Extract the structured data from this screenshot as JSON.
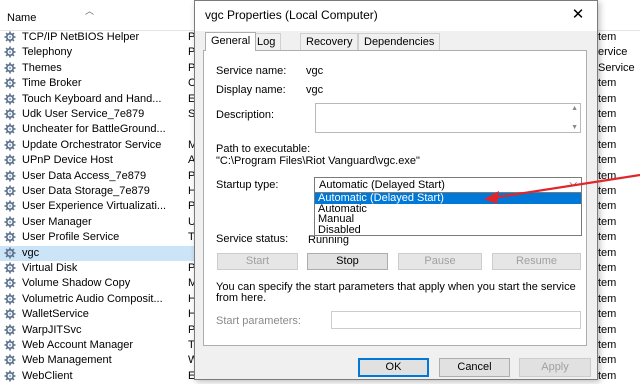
{
  "services": {
    "column_name": "Name",
    "rows": [
      {
        "name": "TCP/IP NetBIOS Helper",
        "desc": "P"
      },
      {
        "name": "Telephony",
        "desc": "P"
      },
      {
        "name": "Themes",
        "desc": "P"
      },
      {
        "name": "Time Broker",
        "desc": "C"
      },
      {
        "name": "Touch Keyboard and Hand...",
        "desc": "E"
      },
      {
        "name": "Udk User Service_7e879",
        "desc": "S"
      },
      {
        "name": "Uncheater for BattleGround...",
        "desc": ""
      },
      {
        "name": "Update Orchestrator Service",
        "desc": "M"
      },
      {
        "name": "UPnP Device Host",
        "desc": "A"
      },
      {
        "name": "User Data Access_7e879",
        "desc": "P"
      },
      {
        "name": "User Data Storage_7e879",
        "desc": "H"
      },
      {
        "name": "User Experience Virtualizati...",
        "desc": "P"
      },
      {
        "name": "User Manager",
        "desc": "U"
      },
      {
        "name": "User Profile Service",
        "desc": "T"
      },
      {
        "name": "vgc",
        "desc": ""
      },
      {
        "name": "Virtual Disk",
        "desc": "P"
      },
      {
        "name": "Volume Shadow Copy",
        "desc": "M"
      },
      {
        "name": "Volumetric Audio Composit...",
        "desc": "H"
      },
      {
        "name": "WalletService",
        "desc": "H"
      },
      {
        "name": "WarpJITSvc",
        "desc": "P"
      },
      {
        "name": "Web Account Manager",
        "desc": "T"
      },
      {
        "name": "Web Management",
        "desc": "W"
      },
      {
        "name": "WebClient",
        "desc": "E"
      }
    ],
    "right_column": [
      "tem",
      "ervice",
      "Service",
      "tem",
      "tem",
      "tem",
      "tem",
      "tem",
      "tem",
      "tem",
      "tem",
      "tem",
      "tem",
      "tem",
      "tem",
      "tem",
      "tem",
      "tem",
      "tem",
      "tem",
      "tem",
      "tem",
      "tem"
    ]
  },
  "dialog": {
    "title": "vgc Properties (Local Computer)",
    "close_glyph": "✕",
    "tabs": [
      "General",
      "Log On",
      "Recovery",
      "Dependencies"
    ],
    "service_name_label": "Service name:",
    "service_name_value": "vgc",
    "display_name_label": "Display name:",
    "display_name_value": "vgc",
    "description_label": "Description:",
    "path_label": "Path to executable:",
    "path_value": "\"C:\\Program Files\\Riot Vanguard\\vgc.exe\"",
    "startup_type_label": "Startup type:",
    "startup_type_value": "Automatic (Delayed Start)",
    "startup_options": [
      "Automatic (Delayed Start)",
      "Automatic",
      "Manual",
      "Disabled"
    ],
    "service_status_label": "Service status:",
    "service_status_value": "Running",
    "start_label": "Start",
    "stop_label": "Stop",
    "pause_label": "Pause",
    "resume_label": "Resume",
    "hint_text_line1": "You can specify the start parameters that apply when you start the service",
    "hint_text_line2": "from here.",
    "start_params_label": "Start parameters:",
    "ok_label": "OK",
    "cancel_label": "Cancel",
    "apply_label": "Apply"
  },
  "colors": {
    "highlight": "#0078d7",
    "annotation_arrow": "#e0262b",
    "selected_row": "#cce4f7"
  }
}
